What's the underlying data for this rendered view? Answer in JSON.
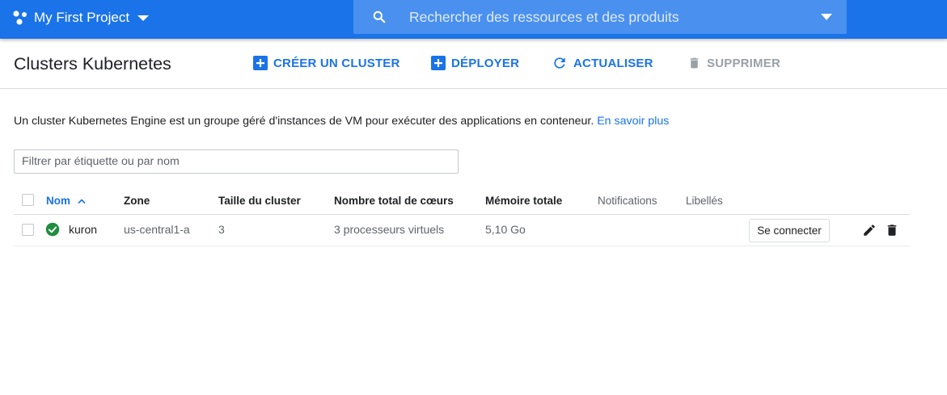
{
  "header": {
    "project_name": "My First Project",
    "search_placeholder": "Rechercher des ressources et des produits"
  },
  "toolbar": {
    "title": "Clusters Kubernetes",
    "create_label": "CRÉER UN CLUSTER",
    "deploy_label": "DÉPLOYER",
    "refresh_label": "ACTUALISER",
    "delete_label": "SUPPRIMER"
  },
  "description": {
    "text": "Un cluster Kubernetes Engine est un groupe géré d'instances de VM pour exécuter des applications en conteneur.",
    "link": "En savoir plus"
  },
  "filter": {
    "placeholder": "Filtrer par étiquette ou par nom"
  },
  "table": {
    "columns": {
      "name": "Nom",
      "zone": "Zone",
      "size": "Taille du cluster",
      "cores": "Nombre total de cœurs",
      "memory": "Mémoire totale",
      "notifications": "Notifications",
      "labels": "Libellés"
    },
    "sorted_column": "name",
    "rows": [
      {
        "status": "ok",
        "name": "kuron",
        "zone": "us-central1-a",
        "size": "3",
        "cores": "3 processeurs virtuels",
        "memory": "5,10 Go",
        "notifications": "",
        "labels": "",
        "connect_label": "Se connecter"
      }
    ]
  },
  "colors": {
    "brand": "#1a73e8",
    "status_ok": "#1e8e3e",
    "disabled": "#9aa0a6"
  }
}
